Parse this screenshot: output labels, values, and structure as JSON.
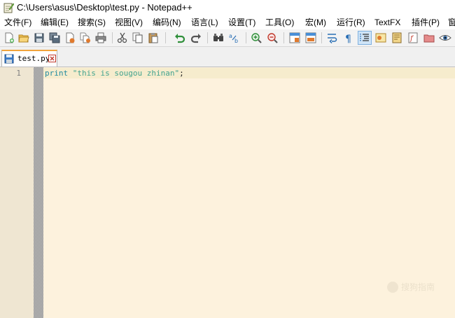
{
  "window": {
    "title": "C:\\Users\\asus\\Desktop\\test.py - Notepad++"
  },
  "menu": [
    {
      "label": "文件(F)"
    },
    {
      "label": "编辑(E)"
    },
    {
      "label": "搜索(S)"
    },
    {
      "label": "视图(V)"
    },
    {
      "label": "编码(N)"
    },
    {
      "label": "语言(L)"
    },
    {
      "label": "设置(T)"
    },
    {
      "label": "工具(O)"
    },
    {
      "label": "宏(M)"
    },
    {
      "label": "运行(R)"
    },
    {
      "label": "TextFX"
    },
    {
      "label": "插件(P)"
    },
    {
      "label": "窗"
    }
  ],
  "toolbar_icons": [
    "new-file",
    "open-file",
    "save",
    "save-all",
    "close",
    "close-all",
    "print",
    "cut",
    "copy",
    "paste",
    "undo",
    "redo",
    "find",
    "replace",
    "zoom-in",
    "zoom-out",
    "sync-vertical",
    "sync-horizontal",
    "word-wrap",
    "show-all-characters",
    "indent-guide",
    "user-defined-language",
    "document-map",
    "function-list",
    "folder-as-workspace",
    "monitoring"
  ],
  "tabs": [
    {
      "label": "test.py"
    }
  ],
  "editor": {
    "line_numbers": [
      "1"
    ],
    "code": {
      "keyword": "print",
      "space": " ",
      "string": "\"this is sougou zhinan\"",
      "terminator": ";"
    }
  },
  "watermark": {
    "text": "搜狗指南"
  },
  "colors": {
    "editor_background": "#fdf2dd",
    "gutter_background": "#efe6d2",
    "keyword": "#208aa0",
    "string": "#42a38f",
    "active_tab_accent": "#f1a43c"
  }
}
